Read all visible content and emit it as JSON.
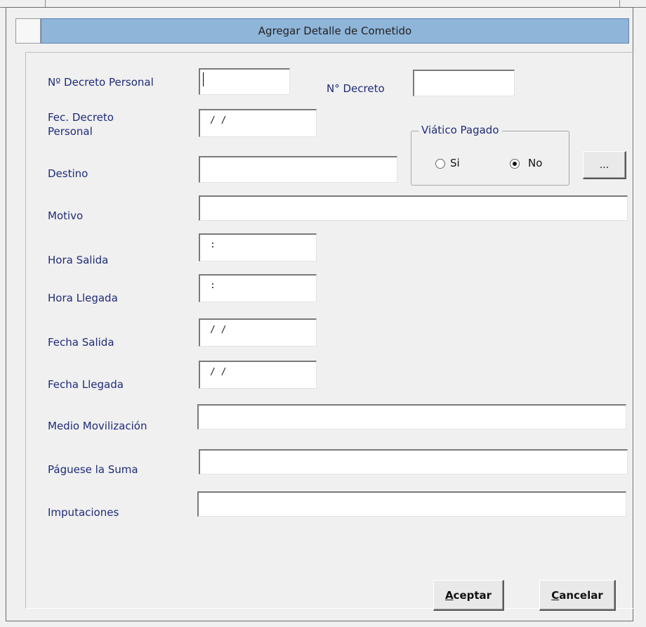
{
  "window": {
    "title": "Agregar Detalle de Cometido"
  },
  "form": {
    "decreto_personal": {
      "label": "Nº  Decreto Personal",
      "value": ""
    },
    "decreto": {
      "label": "N° Decreto",
      "value": ""
    },
    "fec_decreto_personal": {
      "label_line1": "Fec. Decreto",
      "label_line2": "Personal",
      "value": "/ /"
    },
    "destino": {
      "label": "Destino",
      "value": ""
    },
    "viatico_pagado": {
      "title": "Viático Pagado",
      "options": [
        {
          "label": "Si",
          "selected": false
        },
        {
          "label": "No",
          "selected": true
        }
      ]
    },
    "more_button": {
      "label": "..."
    },
    "motivo": {
      "label": "Motivo",
      "value": ""
    },
    "hora_salida": {
      "label": "Hora  Salida",
      "value": ":"
    },
    "hora_llegada": {
      "label": "Hora  Llegada",
      "value": ":"
    },
    "fecha_salida": {
      "label": "Fecha  Salida",
      "value": "/ /"
    },
    "fecha_llegada": {
      "label": "Fecha  Llegada",
      "value": "/ /"
    },
    "medio_movilizacion": {
      "label": "Medio Movilización",
      "value": ""
    },
    "paguese_suma": {
      "label": "Páguese la Suma",
      "value": ""
    },
    "imputaciones": {
      "label": "Imputaciones",
      "value": ""
    }
  },
  "buttons": {
    "accept": "Aceptar",
    "cancel": "Cancelar"
  }
}
